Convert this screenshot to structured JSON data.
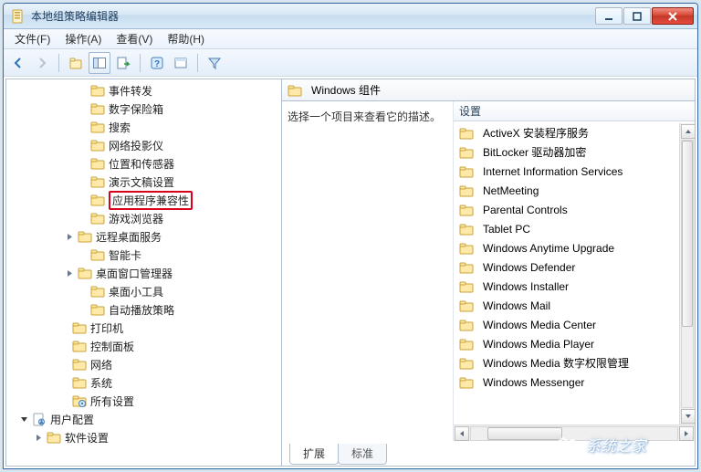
{
  "window": {
    "title": "本地组策略编辑器"
  },
  "menubar": [
    {
      "label": "文件(F)"
    },
    {
      "label": "操作(A)"
    },
    {
      "label": "查看(V)"
    },
    {
      "label": "帮助(H)"
    }
  ],
  "tree": {
    "items": [
      {
        "indent": 76,
        "exp": "none",
        "icon": "folder",
        "label": "事件转发"
      },
      {
        "indent": 76,
        "exp": "none",
        "icon": "folder",
        "label": "数字保险箱"
      },
      {
        "indent": 76,
        "exp": "none",
        "icon": "folder",
        "label": "搜索"
      },
      {
        "indent": 76,
        "exp": "none",
        "icon": "folder",
        "label": "网络投影仪"
      },
      {
        "indent": 76,
        "exp": "none",
        "icon": "folder",
        "label": "位置和传感器"
      },
      {
        "indent": 76,
        "exp": "none",
        "icon": "folder",
        "label": "演示文稿设置"
      },
      {
        "indent": 76,
        "exp": "none",
        "icon": "folder",
        "label": "应用程序兼容性",
        "highlight": true
      },
      {
        "indent": 76,
        "exp": "none",
        "icon": "folder",
        "label": "游戏浏览器"
      },
      {
        "indent": 62,
        "exp": "closed",
        "icon": "folder",
        "label": "远程桌面服务"
      },
      {
        "indent": 76,
        "exp": "none",
        "icon": "folder",
        "label": "智能卡"
      },
      {
        "indent": 62,
        "exp": "closed",
        "icon": "folder",
        "label": "桌面窗口管理器"
      },
      {
        "indent": 76,
        "exp": "none",
        "icon": "folder",
        "label": "桌面小工具"
      },
      {
        "indent": 76,
        "exp": "none",
        "icon": "folder",
        "label": "自动播放策略"
      },
      {
        "indent": 56,
        "exp": "none",
        "icon": "folder",
        "label": "打印机"
      },
      {
        "indent": 56,
        "exp": "none",
        "icon": "folder",
        "label": "控制面板"
      },
      {
        "indent": 56,
        "exp": "none",
        "icon": "folder",
        "label": "网络"
      },
      {
        "indent": 56,
        "exp": "none",
        "icon": "folder",
        "label": "系统"
      },
      {
        "indent": 56,
        "exp": "none",
        "icon": "settings",
        "label": "所有设置"
      },
      {
        "indent": 12,
        "exp": "open",
        "icon": "user",
        "label": "用户配置"
      },
      {
        "indent": 28,
        "exp": "closed",
        "icon": "folder",
        "label": "软件设置"
      }
    ]
  },
  "right": {
    "header_label": "Windows 组件",
    "description_label": "选择一个项目来查看它的描述。",
    "column_header": "设置",
    "items": [
      "ActiveX 安装程序服务",
      "BitLocker 驱动器加密",
      "Internet Information Services",
      "NetMeeting",
      "Parental Controls",
      "Tablet PC",
      "Windows Anytime Upgrade",
      "Windows Defender",
      "Windows Installer",
      "Windows Mail",
      "Windows Media Center",
      "Windows Media Player",
      "Windows Media 数字权限管理",
      "Windows Messenger"
    ],
    "tabs": [
      {
        "label": "扩展",
        "active": true
      },
      {
        "label": "标准",
        "active": false
      }
    ]
  },
  "watermark": {
    "text": "系统之家"
  }
}
